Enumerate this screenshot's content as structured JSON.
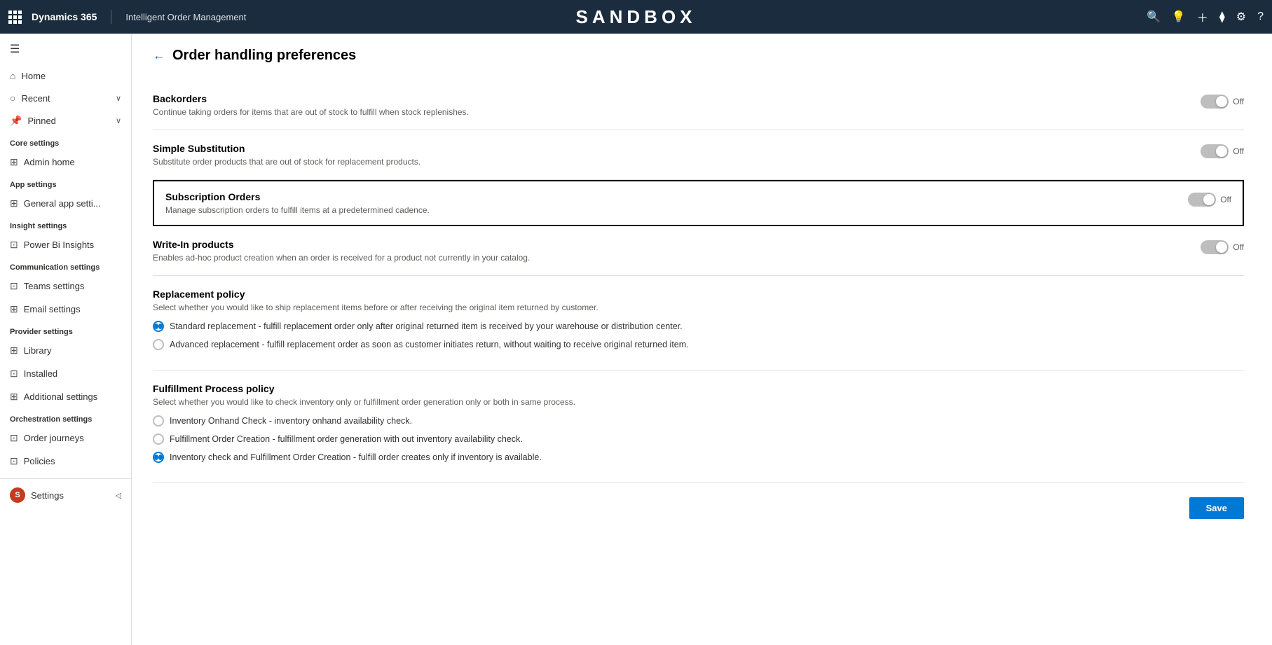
{
  "topbar": {
    "brand": "Dynamics 365",
    "appname": "Intelligent Order Management",
    "sandbox": "SANDBOX"
  },
  "sidebar": {
    "hamburger": "≡",
    "nav": [
      {
        "id": "home",
        "icon": "⌂",
        "label": "Home"
      },
      {
        "id": "recent",
        "icon": "⊙",
        "label": "Recent",
        "chevron": "∨"
      },
      {
        "id": "pinned",
        "icon": "⊡",
        "label": "Pinned",
        "chevron": "∨"
      }
    ],
    "sections": [
      {
        "label": "Core settings",
        "items": [
          {
            "id": "admin-home",
            "icon": "⊞",
            "label": "Admin home"
          }
        ]
      },
      {
        "label": "App settings",
        "items": [
          {
            "id": "general-app",
            "icon": "⊞",
            "label": "General app setti..."
          }
        ]
      },
      {
        "label": "Insight settings",
        "items": [
          {
            "id": "power-bi",
            "icon": "⊡",
            "label": "Power Bi Insights"
          }
        ]
      },
      {
        "label": "Communication settings",
        "items": [
          {
            "id": "teams",
            "icon": "⊡",
            "label": "Teams settings"
          },
          {
            "id": "email",
            "icon": "⊞",
            "label": "Email settings"
          }
        ]
      },
      {
        "label": "Provider settings",
        "items": [
          {
            "id": "library",
            "icon": "⊞",
            "label": "Library"
          },
          {
            "id": "installed",
            "icon": "⊡",
            "label": "Installed"
          },
          {
            "id": "additional",
            "icon": "⊞",
            "label": "Additional settings"
          }
        ]
      },
      {
        "label": "Orchestration settings",
        "items": [
          {
            "id": "order-journeys",
            "icon": "⊡",
            "label": "Order journeys"
          },
          {
            "id": "policies",
            "icon": "⊡",
            "label": "Policies"
          }
        ]
      }
    ],
    "bottom": {
      "avatar_letter": "S",
      "label": "Settings",
      "chevron": "◁"
    }
  },
  "page": {
    "back_label": "←",
    "title": "Order handling preferences",
    "settings": [
      {
        "id": "backorders",
        "title": "Backorders",
        "desc": "Continue taking orders for items that are out of stock to fulfill when stock replenishes.",
        "toggle": "Off",
        "highlighted": false
      },
      {
        "id": "simple-substitution",
        "title": "Simple Substitution",
        "desc": "Substitute order products that are out of stock for replacement products.",
        "toggle": "Off",
        "highlighted": false
      },
      {
        "id": "subscription-orders",
        "title": "Subscription Orders",
        "desc": "Manage subscription orders to fulfill items at a predetermined cadence.",
        "toggle": "Off",
        "highlighted": true
      },
      {
        "id": "write-in-products",
        "title": "Write-In products",
        "desc": "Enables ad-hoc product creation when an order is received for a product not currently in your catalog.",
        "toggle": "Off",
        "highlighted": false
      }
    ],
    "replacement_policy": {
      "title": "Replacement policy",
      "desc": "Select whether you would like to ship replacement items before or after receiving the original item returned by customer.",
      "options": [
        {
          "id": "standard",
          "label": "Standard replacement - fulfill replacement order only after original returned item is received by your warehouse or distribution center.",
          "selected": true
        },
        {
          "id": "advanced",
          "label": "Advanced replacement - fulfill replacement order as soon as customer initiates return, without waiting to receive original returned item.",
          "selected": false
        }
      ]
    },
    "fulfillment_policy": {
      "title": "Fulfillment Process policy",
      "desc": "Select whether you would like to check inventory only or fulfillment order generation only or both in same process.",
      "options": [
        {
          "id": "inventory-check",
          "label": "Inventory Onhand Check - inventory onhand availability check.",
          "selected": false
        },
        {
          "id": "fulfillment-creation",
          "label": "Fulfillment Order Creation - fulfillment order generation with out inventory availability check.",
          "selected": false
        },
        {
          "id": "both",
          "label": "Inventory check and Fulfillment Order Creation - fulfill order creates only if inventory is available.",
          "selected": true
        }
      ]
    },
    "save_button": "Save"
  }
}
